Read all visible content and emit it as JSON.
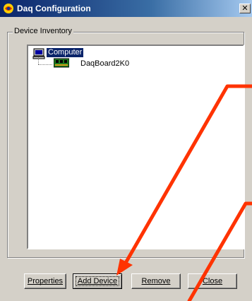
{
  "window": {
    "title": "Daq Configuration",
    "close_label": "✕"
  },
  "group": {
    "label": "Device Inventory"
  },
  "tree": {
    "root_label": "Computer",
    "child_label": "DaqBoard2K0"
  },
  "buttons": {
    "properties": "Properties",
    "add_device": "Add Device",
    "remove": "Remove",
    "close": "Close"
  },
  "colors": {
    "selection": "#0a246a",
    "annotation_arrow": "#ff3300",
    "dialog_face": "#d4d0c8"
  }
}
